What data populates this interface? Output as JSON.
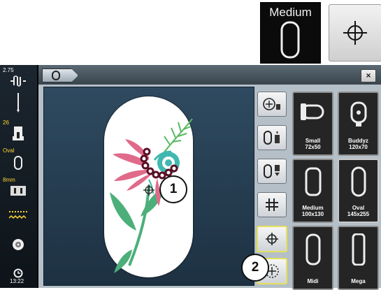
{
  "callout_icons": {
    "hoop_icon_label": "Medium",
    "center_icon": "crosshair-icon"
  },
  "status_bar": {
    "needle_value": "2.75",
    "presser_foot_value": "26",
    "hoop_value": "Oval",
    "stitch_plate_value": "8mm",
    "time": "13:22"
  },
  "header": {
    "hoop_tab_icon": "hoop-oval-icon",
    "close_label": "×"
  },
  "side_buttons": [
    {
      "name": "move-to-hoop-button",
      "icon": "hoop-move-icon"
    },
    {
      "name": "hoop-adjust-button",
      "icon": "hoop-info-icon"
    },
    {
      "name": "hoop-select-button",
      "icon": "hoop-select-icon"
    },
    {
      "name": "grid-toggle-button",
      "icon": "grid-icon"
    },
    {
      "name": "center-button",
      "icon": "crosshair-icon"
    },
    {
      "name": "virtual-positioning-button",
      "icon": "dashed-circle-target-icon"
    }
  ],
  "hoops": [
    {
      "label": "Small\n72x50"
    },
    {
      "label": "Buddyz\n120x70"
    },
    {
      "label": "Medium\n100x130"
    },
    {
      "label": "Oval\n145x255"
    },
    {
      "label": "Midi"
    },
    {
      "label": "Mega"
    }
  ],
  "callouts": [
    "1",
    "2"
  ],
  "colors": {
    "status_text": "#ffd633",
    "selected_border": "#e6e15a",
    "design_pink": "#e06a8a",
    "design_dark": "#5a0f25",
    "design_green": "#4caf7a",
    "design_teal": "#40b8b0"
  }
}
